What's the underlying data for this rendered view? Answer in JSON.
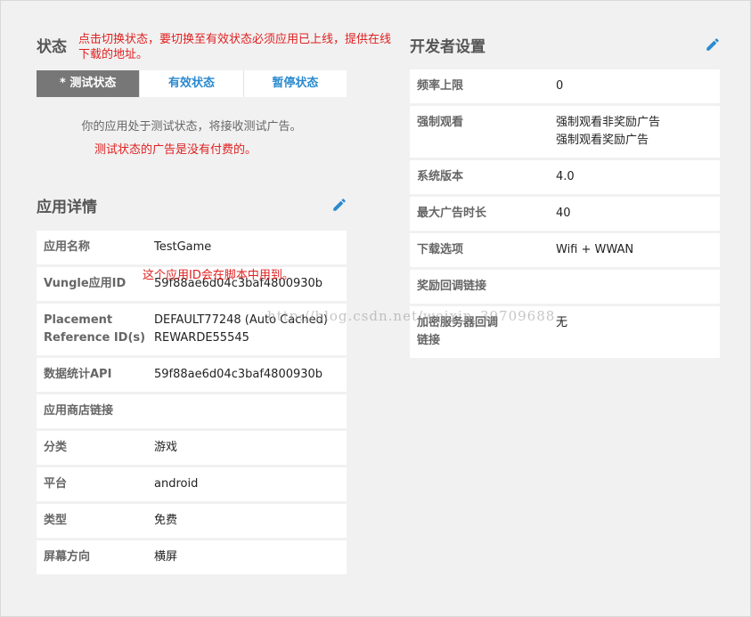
{
  "status": {
    "title": "状态",
    "note": "点击切换状态，要切换至有效状态必须应用已上线，提供在线下载的地址。",
    "tabs": [
      {
        "label": "* 测试状态"
      },
      {
        "label": "有效状态"
      },
      {
        "label": "暂停状态"
      }
    ],
    "description": "你的应用处于测试状态，将接收测试广告。",
    "warning": "测试状态的广告是没有付费的。"
  },
  "app_details": {
    "title": "应用详情",
    "annotation": "这个应用ID会在脚本中用到。",
    "rows": [
      {
        "key": "应用名称",
        "value": "TestGame"
      },
      {
        "key": "Vungle应用ID",
        "value": "59f88ae6d04c3baf4800930b"
      },
      {
        "key": "Placement\nReference ID(s)",
        "value": "DEFAULT77248 (Auto Cached)\nREWARDE55545"
      },
      {
        "key": "数据统计API",
        "value": "59f88ae6d04c3baf4800930b"
      },
      {
        "key": "应用商店链接",
        "value": ""
      },
      {
        "key": "分类",
        "value": "游戏"
      },
      {
        "key": "平台",
        "value": "android"
      },
      {
        "key": "类型",
        "value": "免费"
      },
      {
        "key": "屏幕方向",
        "value": "横屏"
      }
    ]
  },
  "developer_settings": {
    "title": "开发者设置",
    "rows": [
      {
        "key": "频率上限",
        "value": "0"
      },
      {
        "key": "强制观看",
        "value": "强制观看非奖励广告\n强制观看奖励广告"
      },
      {
        "key": "系统版本",
        "value": "4.0"
      },
      {
        "key": "最大广告时长",
        "value": "40"
      },
      {
        "key": "下载选项",
        "value": "Wifi + WWAN"
      },
      {
        "key": "奖励回调链接",
        "value": ""
      },
      {
        "key": "加密服务器回调\n链接",
        "value": "无"
      }
    ]
  },
  "watermark": "http://blog.csdn.net/weixin_39709688",
  "colors": {
    "accent": "#2a8ad0",
    "annotation": "#e02020",
    "active_tab": "#777777"
  },
  "icons": {
    "edit": "pencil-icon"
  }
}
